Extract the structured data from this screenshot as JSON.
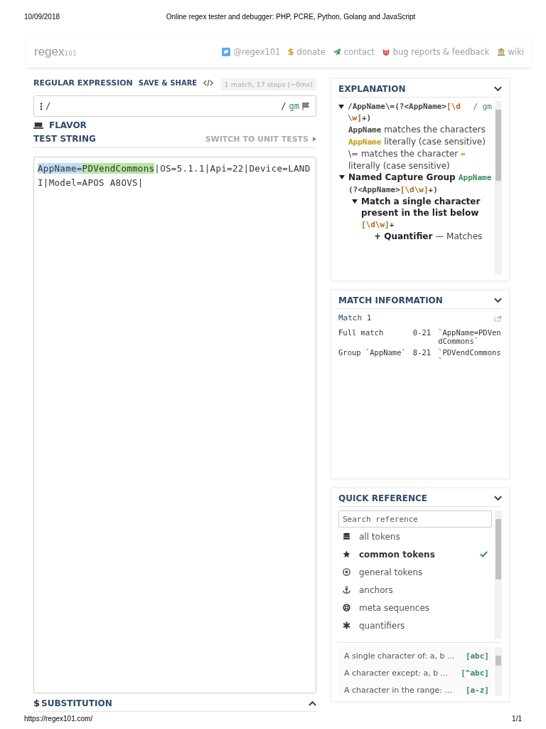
{
  "print_header": {
    "date": "10/09/2018",
    "title": "Online regex tester and debugger: PHP, PCRE, Python, Golang and JavaScript"
  },
  "navbar": {
    "logo": "regex",
    "logo_suffix": "101",
    "links": [
      {
        "kind": "twitter",
        "label": "@regex101"
      },
      {
        "kind": "dollar",
        "glyph": "$",
        "label": "donate"
      },
      {
        "kind": "plane",
        "label": "contact"
      },
      {
        "kind": "bug",
        "label": "bug reports & feedback"
      },
      {
        "kind": "bank",
        "label": "wiki"
      }
    ]
  },
  "regex_section": {
    "title": "REGULAR EXPRESSION",
    "share_label": "SAVE & SHARE",
    "status": "1 match, 17 steps (~0ms)",
    "open_delimiter": "/",
    "close_delimiter": "/",
    "flags": "gm"
  },
  "flavor": {
    "title": "FLAVOR"
  },
  "test_string": {
    "title": "TEST STRING",
    "switch_label": "SWITCH TO UNIT TESTS",
    "segments": [
      {
        "text": "AppName=",
        "kind": "full"
      },
      {
        "text": "PDVendCommons",
        "kind": "group"
      },
      {
        "text": "|OS=5.1.1|Api=22|Device=LANDI|Model=APOS A8OVS|",
        "kind": "none"
      }
    ]
  },
  "substitution": {
    "title": "SUBSTITUTION",
    "glyph": "$",
    "expanded": false
  },
  "explanation": {
    "title": "EXPLANATION",
    "expanded": true,
    "root": {
      "expanded": true,
      "open": "/",
      "segments": [
        {
          "kind": "code",
          "text": "AppName\\=(?<AppName>"
        },
        {
          "kind": "class",
          "text": "[\\d\\w]"
        },
        {
          "kind": "code",
          "text": "+)"
        }
      ],
      "flags": "/ gm",
      "children": [
        {
          "segments": [
            {
              "kind": "code",
              "text": "AppName"
            },
            {
              "kind": "text",
              "text": " matches the characters "
            },
            {
              "kind": "literal",
              "text": "AppName"
            },
            {
              "kind": "text",
              "text": " literally (case sensitive)"
            }
          ]
        },
        {
          "segments": [
            {
              "kind": "text",
              "text": "\\= matches the character "
            },
            {
              "kind": "literal",
              "text": "="
            },
            {
              "kind": "text",
              "text": " literally (case sensitive)"
            }
          ]
        },
        {
          "expanded": true,
          "segments": [
            {
              "kind": "bold",
              "text": "Named Capture Group "
            },
            {
              "kind": "group",
              "text": "AppName"
            }
          ],
          "pattern": [
            {
              "kind": "code",
              "text": "(?<AppName>"
            },
            {
              "kind": "class",
              "text": "[\\d\\w]"
            },
            {
              "kind": "code",
              "text": "+)"
            }
          ],
          "children": [
            {
              "expanded": true,
              "segments": [
                {
                  "kind": "bold",
                  "text": "Match a single character present in the list below"
                }
              ],
              "pattern": [
                {
                  "kind": "class",
                  "text": "[\\d\\w]"
                },
                {
                  "kind": "code",
                  "text": "+"
                }
              ],
              "children": [
                {
                  "segments": [
                    {
                      "kind": "bold",
                      "text": "+ Quantifier"
                    },
                    {
                      "kind": "text",
                      "text": " — Matches"
                    }
                  ]
                }
              ]
            }
          ]
        }
      ]
    }
  },
  "match_information": {
    "title": "MATCH INFORMATION",
    "expanded": true,
    "match_title": "Match 1",
    "rows": [
      {
        "label": "Full match",
        "range": "0-21",
        "value": "`AppName=PDVendCommons`"
      },
      {
        "label": "Group `AppName`",
        "range": "8-21",
        "value": "`PDVendCommons`"
      }
    ]
  },
  "quick_reference": {
    "title": "QUICK REFERENCE",
    "expanded": true,
    "search": {
      "placeholder": "Search reference"
    },
    "categories": [
      {
        "kind": "database",
        "label": "all tokens",
        "selected": false
      },
      {
        "kind": "star",
        "label": "common tokens",
        "selected": true
      },
      {
        "kind": "target",
        "label": "general tokens",
        "selected": false
      },
      {
        "kind": "anchor",
        "label": "anchors",
        "selected": false
      },
      {
        "kind": "lifebuoy",
        "label": "meta sequences",
        "selected": false
      },
      {
        "kind": "asterisk",
        "label": "quantifiers",
        "selected": false
      }
    ],
    "tokens": [
      {
        "description": "A single character of: a, b ...",
        "token": "[abc]"
      },
      {
        "description": "A character except: a, b ...",
        "token": "[^abc]"
      },
      {
        "description": "A character in the range: ...",
        "token": "[a-z]"
      }
    ]
  },
  "print_footer": {
    "url": "https://regex101.com/",
    "page": "1/1"
  }
}
